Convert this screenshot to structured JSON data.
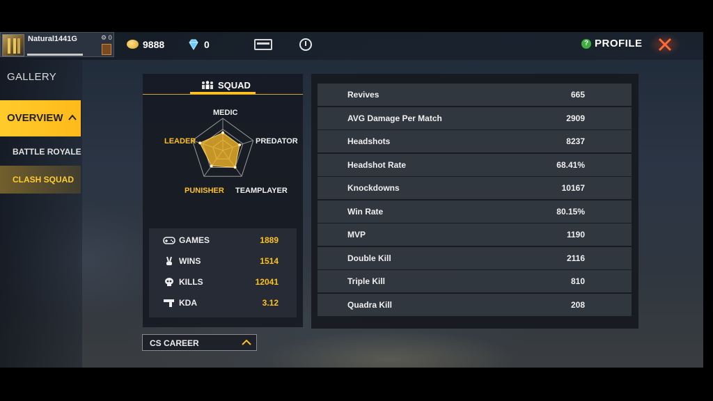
{
  "player": {
    "name": "Natural1441G",
    "level": "0"
  },
  "currency": {
    "gold": "9888",
    "diamonds": "0"
  },
  "header": {
    "profile_label": "PROFILE",
    "help_glyph": "?"
  },
  "nav": {
    "gallery": "GALLERY",
    "overview": "OVERVIEW",
    "battle_royale": "BATTLE ROYALE",
    "clash_squad": "CLASH SQUAD"
  },
  "squad": {
    "title": "SQUAD",
    "radar": {
      "axes": [
        "MEDIC",
        "PREDATOR",
        "TEAMPLAYER",
        "PUNISHER",
        "LEADER"
      ],
      "values": [
        0.55,
        0.55,
        0.65,
        0.6,
        0.75
      ],
      "highlighted_axes": [
        "LEADER",
        "PUNISHER"
      ]
    },
    "stats": [
      {
        "label": "GAMES",
        "value": "1889",
        "icon": "gamepad-icon"
      },
      {
        "label": "WINS",
        "value": "1514",
        "icon": "victory-hand-icon"
      },
      {
        "label": "KILLS",
        "value": "12041",
        "icon": "skull-icon"
      },
      {
        "label": "KDA",
        "value": "3.12",
        "icon": "pistol-icon"
      }
    ]
  },
  "career_select": {
    "selected": "CS CAREER"
  },
  "details": [
    {
      "label": "Revives",
      "value": "665"
    },
    {
      "label": "AVG Damage Per Match",
      "value": "2909"
    },
    {
      "label": "Headshots",
      "value": "8237"
    },
    {
      "label": "Headshot Rate",
      "value": "68.41%"
    },
    {
      "label": "Knockdowns",
      "value": "10167"
    },
    {
      "label": "Win Rate",
      "value": "80.15%"
    },
    {
      "label": "MVP",
      "value": "1190"
    },
    {
      "label": "Double Kill",
      "value": "2116"
    },
    {
      "label": "Triple Kill",
      "value": "810"
    },
    {
      "label": "Quadra Kill",
      "value": "208"
    }
  ],
  "colors": {
    "accent": "#ffc21a",
    "panel": "#161a22",
    "row": "#343942"
  }
}
